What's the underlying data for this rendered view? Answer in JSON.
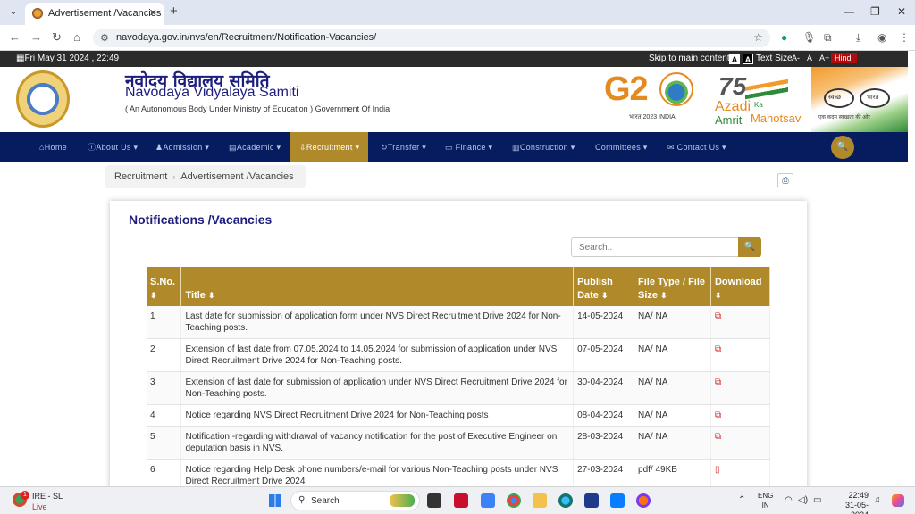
{
  "browser": {
    "tab_title": "Advertisement /Vacancies",
    "url": "navodaya.gov.in/nvs/en/Recruitment/Notification-Vacancies/"
  },
  "topstrip": {
    "date": "Fri May 31 2024 , 22:49",
    "skip": "Skip to main content",
    "contrast_a1": "A",
    "contrast_a2": "A",
    "text_size": "Text Size",
    "ts_minus": "A-",
    "ts_normal": "A",
    "ts_plus": "A+",
    "hindi": "Hindi"
  },
  "header": {
    "hindi_title": "नवोदय विद्यालय समिति",
    "title": "Navodaya Vidyalaya Samiti",
    "subtitle": "( An Autonomous Body Under Ministry of Education ) Government Of India",
    "g20": "G2",
    "g20_sub": "भारत 2023 INDIA",
    "azadi_75": "75",
    "azadi_1": "Azadi",
    "azadi_ka": "Ka",
    "azadi_2": "Amrit",
    "azadi_3": "Mahotsav",
    "swachh_l": "स्वच्छ",
    "swachh_r": "भारत",
    "swachh_sub": "एक कदम स्वच्छता की ओर"
  },
  "nav": {
    "home": "Home",
    "about": "About Us ▾",
    "admission": "Admission ▾",
    "academic": "Academic ▾",
    "recruitment": "Recruitment ▾",
    "transfer": "Transfer ▾",
    "finance": "Finance ▾",
    "construction": "Construction ▾",
    "committees": "Committees ▾",
    "contact": "Contact Us ▾"
  },
  "breadcrumb": {
    "item1": "Recruitment",
    "item2": "Advertisement /Vacancies"
  },
  "main": {
    "title": "Notifications /Vacancies",
    "search_placeholder": "Search..",
    "columns": {
      "sno": "S.No.",
      "title": "Title",
      "publish_1": "Publish",
      "publish_2": "Date",
      "type_1": "File Type / File",
      "type_2": "Size",
      "download": "Download"
    },
    "rows": [
      {
        "sno": "1",
        "title": "Last date for submission of application form under NVS Direct Recruitment Drive 2024 for Non-Teaching posts.",
        "date": "14-05-2024",
        "type": "NA/ NA"
      },
      {
        "sno": "2",
        "title": "Extension of last date from 07.05.2024 to 14.05.2024 for submission of application under NVS Direct Recruitment Drive 2024 for Non-Teaching posts.",
        "date": "07-05-2024",
        "type": "NA/ NA"
      },
      {
        "sno": "3",
        "title": "Extension of last date for submission of application under NVS Direct Recruitment Drive 2024 for Non-Teaching posts.",
        "date": "30-04-2024",
        "type": "NA/ NA"
      },
      {
        "sno": "4",
        "title": "Notice regarding NVS Direct Recruitment Drive 2024 for Non-Teaching posts",
        "date": "08-04-2024",
        "type": "NA/ NA"
      },
      {
        "sno": "5",
        "title": "Notification -regarding withdrawal of vacancy notification for the post of Executive Engineer on deputation basis in NVS.",
        "date": "28-03-2024",
        "type": "NA/ NA"
      },
      {
        "sno": "6",
        "title": "Notice regarding Help Desk phone numbers/e-mail for various Non-Teaching posts under NVS Direct Recruitment Drive 2024",
        "date": "27-03-2024",
        "type": "pdf/ 49KB"
      }
    ]
  },
  "taskbar": {
    "weather_1": "IRE - SL",
    "weather_2": "Live",
    "badge": "1",
    "search": "Search",
    "lang_1": "ENG",
    "lang_2": "IN",
    "time": "22:49",
    "date": "31-05-2024"
  }
}
